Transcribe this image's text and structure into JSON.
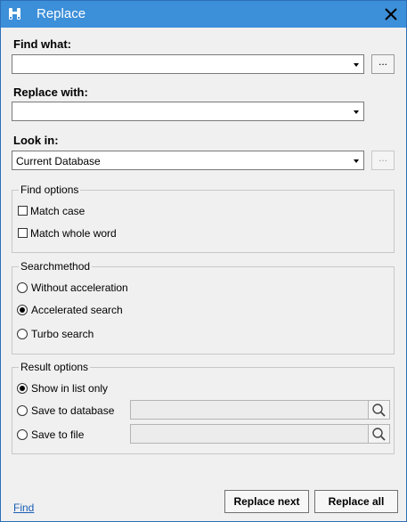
{
  "window": {
    "title": "Replace",
    "icon": "binoculars-icon",
    "close_icon": "close-icon"
  },
  "find_what": {
    "label": "Find what:",
    "value": "",
    "browse_label": "..."
  },
  "replace_with": {
    "label": "Replace with:",
    "value": ""
  },
  "look_in": {
    "label": "Look in:",
    "value": "Current Database",
    "browse_label": "..."
  },
  "find_options": {
    "legend": "Find options",
    "match_case": {
      "label": "Match case",
      "checked": false
    },
    "match_whole_word": {
      "label": "Match whole word",
      "checked": false
    }
  },
  "search_method": {
    "legend": "Searchmethod",
    "options": [
      {
        "label": "Without acceleration",
        "checked": false
      },
      {
        "label": "Accelerated search",
        "checked": true
      },
      {
        "label": "Turbo search",
        "checked": false
      }
    ]
  },
  "result_options": {
    "legend": "Result options",
    "show_in_list": {
      "label": "Show in list only",
      "checked": true
    },
    "save_to_database": {
      "label": "Save to database",
      "checked": false,
      "value": ""
    },
    "save_to_file": {
      "label": "Save to file",
      "checked": false,
      "value": ""
    }
  },
  "footer": {
    "find_link": "Find",
    "replace_next": "Replace next",
    "replace_all": "Replace all"
  },
  "colors": {
    "titlebar": "#3c8fd9",
    "link": "#1a5fb4"
  }
}
